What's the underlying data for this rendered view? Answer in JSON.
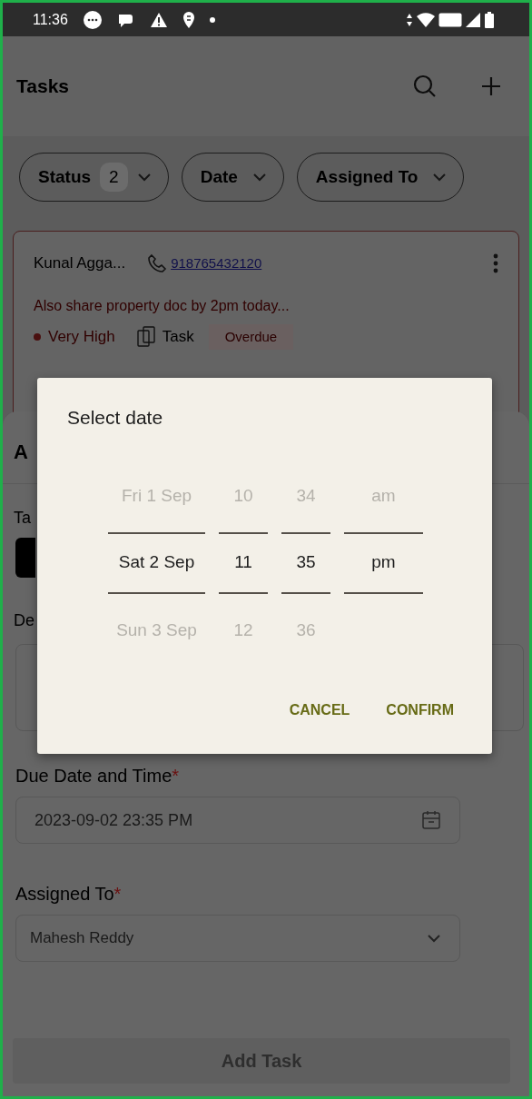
{
  "status_bar": {
    "time": "11:36"
  },
  "header": {
    "title": "Tasks"
  },
  "filters": [
    {
      "label": "Status",
      "count": "2"
    },
    {
      "label": "Date"
    },
    {
      "label": "Assigned To"
    }
  ],
  "task_card": {
    "name": "Kunal Agga...",
    "phone": "918765432120",
    "note": "Also share property doc by 2pm today...",
    "priority": "Very High",
    "type": "Task",
    "status_tag": "Overdue"
  },
  "sheet": {
    "title": "A",
    "type_label": "Ta",
    "description_label": "De",
    "due_label": "Due Date and Time",
    "due_value": "2023-09-02 23:35 PM",
    "assigned_label": "Assigned To",
    "assigned_value": "Mahesh Reddy",
    "required_mark": "*",
    "submit": "Add Task",
    "submit_disabled": true
  },
  "dialog": {
    "title": "Select date",
    "columns": [
      {
        "kind": "date",
        "items": [
          {
            "text": "Fri 1 Sep",
            "selected": false
          },
          {
            "text": "Sat 2 Sep",
            "selected": true
          },
          {
            "text": "Sun 3 Sep",
            "selected": false
          }
        ]
      },
      {
        "kind": "hour",
        "items": [
          {
            "text": "10",
            "selected": false
          },
          {
            "text": "11",
            "selected": true
          },
          {
            "text": "12",
            "selected": false
          }
        ]
      },
      {
        "kind": "minute",
        "items": [
          {
            "text": "34",
            "selected": false
          },
          {
            "text": "35",
            "selected": true
          },
          {
            "text": "36",
            "selected": false
          }
        ]
      },
      {
        "kind": "ampm",
        "items": [
          {
            "text": "am",
            "selected": false
          },
          {
            "text": "pm",
            "selected": true
          }
        ]
      }
    ],
    "buttons": [
      "CANCEL",
      "CONFIRM"
    ]
  }
}
